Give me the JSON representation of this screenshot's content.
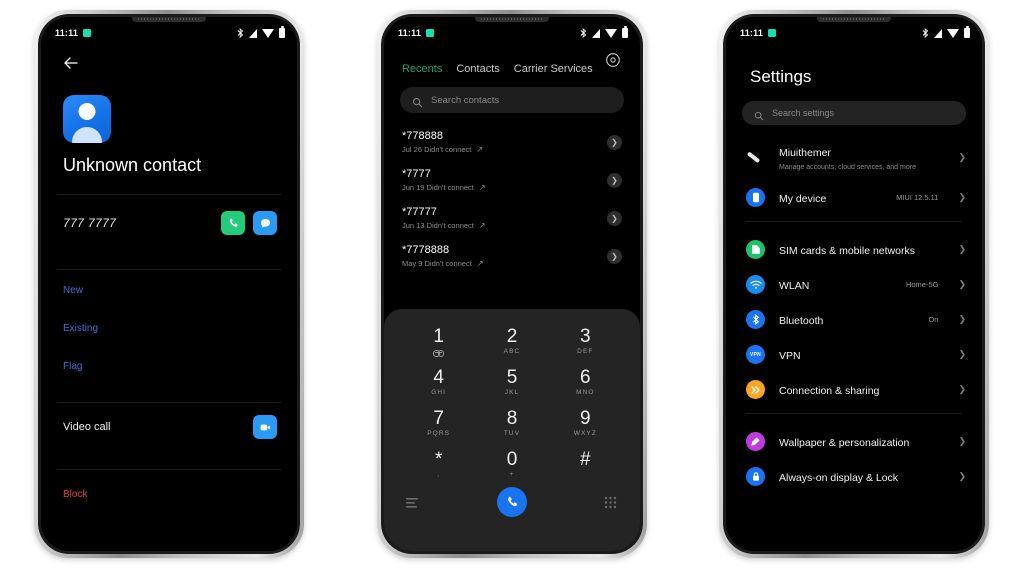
{
  "statusbar": {
    "time": "11:11",
    "icons": [
      "bluetooth-icon",
      "signal-icon",
      "wifi-icon",
      "battery-icon"
    ]
  },
  "phone1": {
    "screen_name": "contact-details",
    "back_icon": "back-arrow-icon",
    "avatar_icon": "person-avatar-icon",
    "contact_name": "Unknown contact",
    "number": "777 7777",
    "call_icon": "phone-call-icon",
    "message_icon": "message-bubble-icon",
    "options": [
      {
        "label": "New",
        "style": "link"
      },
      {
        "label": "Existing",
        "style": "link"
      },
      {
        "label": "Flag",
        "style": "link"
      }
    ],
    "video_call": {
      "label": "Video call",
      "icon": "video-camera-icon"
    },
    "block": {
      "label": "Block",
      "style": "danger"
    },
    "colors": {
      "link": "#3f6fd8",
      "danger": "#e0453a",
      "call": "#23cc7a",
      "message": "#2a9bf5"
    }
  },
  "phone2": {
    "screen_name": "phone-dialer",
    "settings_icon": "gear-icon",
    "tabs": [
      {
        "label": "Recents",
        "active": true
      },
      {
        "label": "Contacts",
        "active": false
      },
      {
        "label": "Carrier Services",
        "active": false
      }
    ],
    "search": {
      "placeholder": "Search contacts",
      "icon": "search-icon"
    },
    "calls": [
      {
        "number": "*778888",
        "detail": "Jul 26 Didn't connect",
        "direction": "outgoing"
      },
      {
        "number": "*7777",
        "detail": "Jun 19 Didn't connect",
        "direction": "outgoing"
      },
      {
        "number": "*77777",
        "detail": "Jun 13 Didn't connect",
        "direction": "outgoing"
      },
      {
        "number": "*7778888",
        "detail": "May 9 Didn't connect",
        "direction": "outgoing"
      }
    ],
    "dialpad": {
      "keys": [
        {
          "num": "1",
          "sub": "",
          "icon": "voicemail-icon"
        },
        {
          "num": "2",
          "sub": "ABC"
        },
        {
          "num": "3",
          "sub": "DEF"
        },
        {
          "num": "4",
          "sub": "GHI"
        },
        {
          "num": "5",
          "sub": "JKL"
        },
        {
          "num": "6",
          "sub": "MNO"
        },
        {
          "num": "7",
          "sub": "PQRS"
        },
        {
          "num": "8",
          "sub": "TUV"
        },
        {
          "num": "9",
          "sub": "WXYZ"
        },
        {
          "num": "*",
          "sub": ","
        },
        {
          "num": "0",
          "sub": "+"
        },
        {
          "num": "#",
          "sub": ""
        }
      ],
      "left_icon": "list-icon",
      "right_icon": "dialpad-grid-icon",
      "call_button_icon": "phone-call-icon",
      "call_button_color": "#1a73f0"
    },
    "active_tab_color": "#1ea362"
  },
  "phone3": {
    "screen_name": "settings",
    "title": "Settings",
    "search": {
      "placeholder": "Search settings",
      "icon": "search-icon"
    },
    "groups": [
      {
        "rows": [
          {
            "label": "Miuithemer",
            "sub": "Manage accounts, cloud services, and more",
            "value": "",
            "icon": "brush-icon",
            "icon_color": "transparent"
          },
          {
            "label": "My device",
            "sub": "",
            "value": "MIUI 12.5.11",
            "icon": "device-icon",
            "icon_color": "#1a73f0"
          }
        ]
      },
      {
        "rows": [
          {
            "label": "SIM cards & mobile networks",
            "sub": "",
            "value": "",
            "icon": "sim-card-icon",
            "icon_color": "#1fc16b"
          },
          {
            "label": "WLAN",
            "sub": "",
            "value": "Home-5G",
            "icon": "wifi-icon",
            "icon_color": "#1a8cf0"
          },
          {
            "label": "Bluetooth",
            "sub": "",
            "value": "On",
            "icon": "bluetooth-icon",
            "icon_color": "#1a73f0"
          },
          {
            "label": "VPN",
            "sub": "",
            "value": "",
            "icon": "vpn-icon",
            "icon_color": "#1a73f0"
          },
          {
            "label": "Connection & sharing",
            "sub": "",
            "value": "",
            "icon": "connection-sharing-icon",
            "icon_color": "#f5a623"
          }
        ]
      },
      {
        "rows": [
          {
            "label": "Wallpaper & personalization",
            "sub": "",
            "value": "",
            "icon": "wallpaper-icon",
            "icon_color": "#c13ae0"
          },
          {
            "label": "Always-on display & Lock",
            "sub": "",
            "value": "",
            "icon": "lock-icon",
            "icon_color": "#1a73f0"
          }
        ]
      }
    ]
  }
}
